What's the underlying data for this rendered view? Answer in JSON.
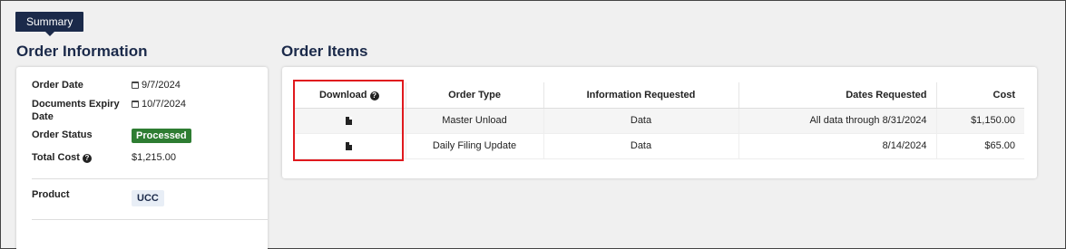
{
  "tabs": {
    "summary": "Summary"
  },
  "order_information": {
    "title": "Order Information",
    "order_date": {
      "label": "Order Date",
      "value": "9/7/2024"
    },
    "documents_expiry": {
      "label": "Documents Expiry Date",
      "value": "10/7/2024"
    },
    "order_status": {
      "label": "Order Status",
      "value": "Processed"
    },
    "total_cost": {
      "label": "Total Cost",
      "value": "$1,215.00"
    },
    "product": {
      "label": "Product",
      "value": "UCC"
    }
  },
  "order_items": {
    "title": "Order Items",
    "headers": {
      "download": "Download",
      "order_type": "Order Type",
      "information_requested": "Information Requested",
      "dates_requested": "Dates Requested",
      "cost": "Cost"
    },
    "rows": [
      {
        "order_type": "Master Unload",
        "information_requested": "Data",
        "dates_requested": "All data through 8/31/2024",
        "cost": "$1,150.00",
        "download_icon": "file-download-icon"
      },
      {
        "order_type": "Daily Filing Update",
        "information_requested": "Data",
        "dates_requested": "8/14/2024",
        "cost": "$65.00",
        "download_icon": "file-download-icon"
      }
    ]
  },
  "colors": {
    "brand_navy": "#1b2a4a",
    "status_green": "#2e7d32",
    "highlight_red": "#e0191e"
  }
}
